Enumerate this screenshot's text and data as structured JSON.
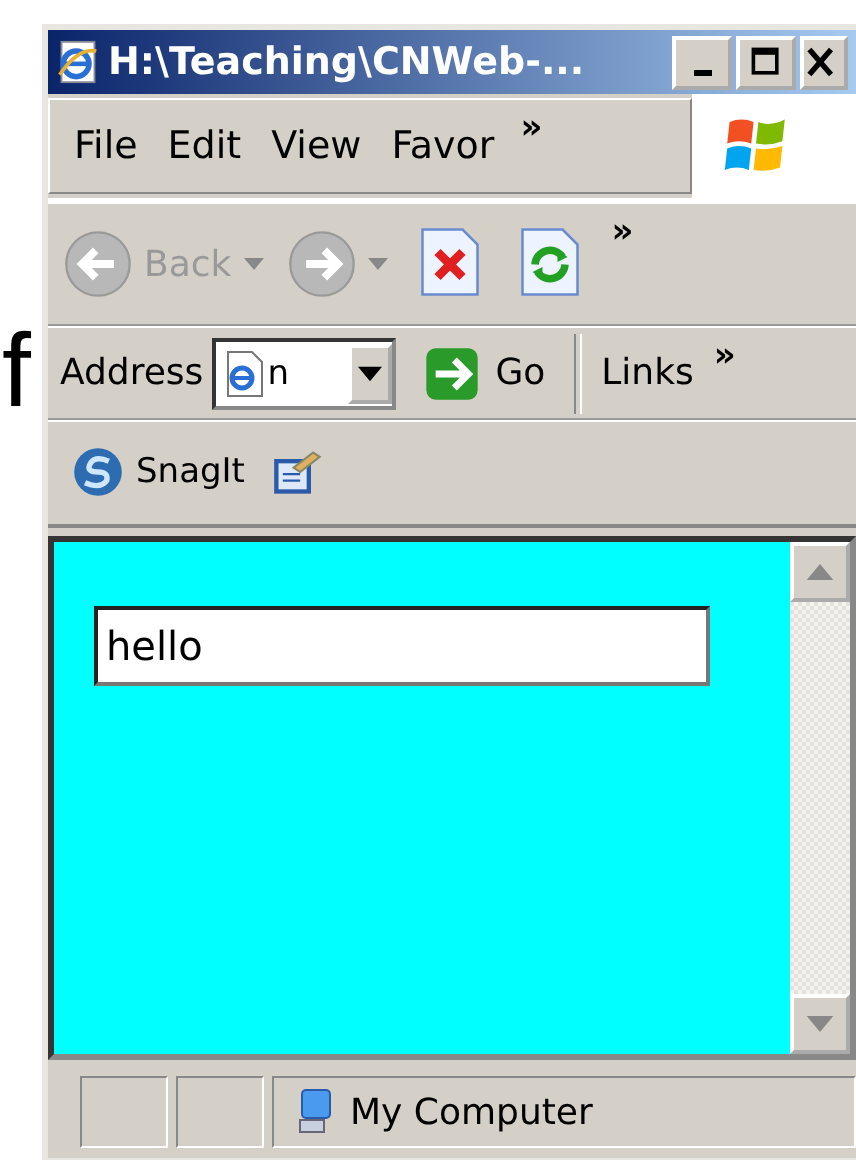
{
  "stray_text": "f",
  "window": {
    "title": "H:\\Teaching\\CNWeb-..."
  },
  "menu": {
    "items": [
      "File",
      "Edit",
      "View",
      "Favor"
    ],
    "overflow": "»"
  },
  "toolbar": {
    "buttons": [
      {
        "kind": "back",
        "label": "Back",
        "disabled": true
      },
      {
        "kind": "forward",
        "disabled": true
      },
      {
        "kind": "stop",
        "disabled": false
      },
      {
        "kind": "refresh",
        "disabled": false
      }
    ],
    "overflow": "»"
  },
  "address_bar": {
    "label": "Address",
    "value": "n",
    "go": "Go",
    "links": "Links",
    "overflow": "»"
  },
  "extra_toolbar": {
    "items": [
      {
        "kind": "snagit",
        "label": "SnagIt"
      },
      {
        "kind": "edit"
      }
    ]
  },
  "content": {
    "input": {
      "value": "hello"
    }
  },
  "status_bar": {
    "zone": "My Computer"
  }
}
